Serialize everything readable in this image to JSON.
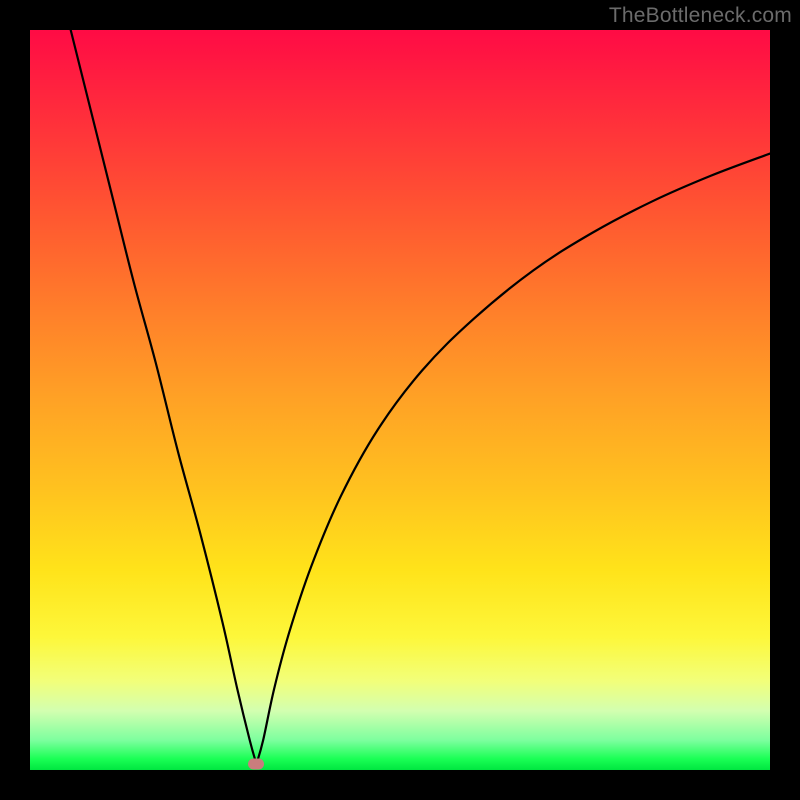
{
  "attribution": "TheBottleneck.com",
  "chart_data": {
    "type": "line",
    "title": "",
    "xlabel": "",
    "ylabel": "",
    "xlim": [
      0,
      100
    ],
    "ylim": [
      0,
      100
    ],
    "grid": false,
    "legend": false,
    "series": [
      {
        "name": "bottleneck-left",
        "x": [
          5.5,
          8,
          11,
          14,
          17,
          20,
          23,
          26,
          28,
          29.7,
          30.6
        ],
        "values": [
          100,
          90,
          78,
          66,
          55,
          43,
          32,
          20,
          11,
          4,
          0.8
        ]
      },
      {
        "name": "bottleneck-right",
        "x": [
          30.6,
          31.5,
          33,
          35,
          38,
          42,
          47,
          53,
          60,
          68,
          76,
          84,
          92,
          100
        ],
        "values": [
          0.8,
          4,
          11,
          18.5,
          27.5,
          37,
          46,
          54,
          61,
          67.5,
          72.6,
          76.8,
          80.3,
          83.3
        ]
      }
    ],
    "marker": {
      "name": "optimal-point",
      "x": 30.6,
      "y": 0.8,
      "color": "#c97d7d"
    },
    "background_gradient": {
      "stops": [
        {
          "pos": 0.0,
          "color": "#ff0b45"
        },
        {
          "pos": 0.5,
          "color": "#ffa225"
        },
        {
          "pos": 0.82,
          "color": "#fdf73a"
        },
        {
          "pos": 1.0,
          "color": "#00e640"
        }
      ]
    }
  }
}
